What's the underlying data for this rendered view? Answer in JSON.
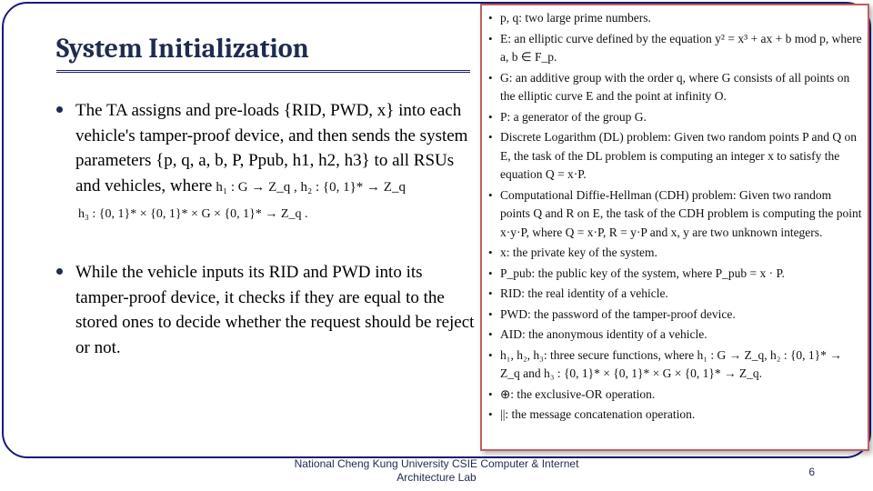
{
  "title": "System Initialization",
  "bullets": [
    {
      "text": "The TA assigns and pre-loads {RID, PWD, x} into each vehicle's tamper-proof device, and then sends the system parameters {p, q, a, b, P, Ppub, h1, h2, h3} to all RSUs and vehicles, where",
      "math_inline": "h₁ : G → Z_q ,  h₂ : {0, 1}* → Z_q",
      "math_block": "h₃ : {0, 1}* × {0, 1}* × G × {0, 1}* → Z_q ."
    },
    {
      "text": "While the vehicle inputs its RID and PWD into its tamper-proof device, it checks if they are equal to the stored ones to decide whether the request should be reject or not."
    }
  ],
  "sidebar": [
    "p, q: two large prime numbers.",
    "E: an elliptic curve defined by the equation y² = x³ + ax + b mod p, where a, b ∈ F_p.",
    "G: an additive group with the order q, where G consists of all points on the elliptic curve E and the point at infinity O.",
    "P: a generator of the group G.",
    "Discrete Logarithm (DL) problem: Given two random points P and Q on E, the task of the DL problem is computing an integer x to satisfy the equation Q = x·P.",
    "Computational Diffie-Hellman (CDH) problem: Given two random points Q and R on E, the task of the CDH problem is computing the point x·y·P, where Q = x·P, R = y·P and x, y are two unknown integers.",
    "x: the private key of the system.",
    "P_pub: the public key of the system, where P_pub = x · P.",
    "RID: the real identity of a vehicle.",
    "PWD: the password of the tamper-proof device.",
    "AID: the anonymous identity of a vehicle.",
    "h₁, h₂, h₃: three secure functions, where h₁ : G → Z_q, h₂ : {0, 1}* → Z_q and h₃ : {0, 1}* × {0, 1}* × G × {0, 1}* → Z_q.",
    "⊕: the exclusive-OR operation.",
    "||: the message concatenation operation."
  ],
  "footer": {
    "line1": "National Cheng Kung University CSIE Computer & Internet",
    "line2": "Architecture Lab"
  },
  "page": "6"
}
